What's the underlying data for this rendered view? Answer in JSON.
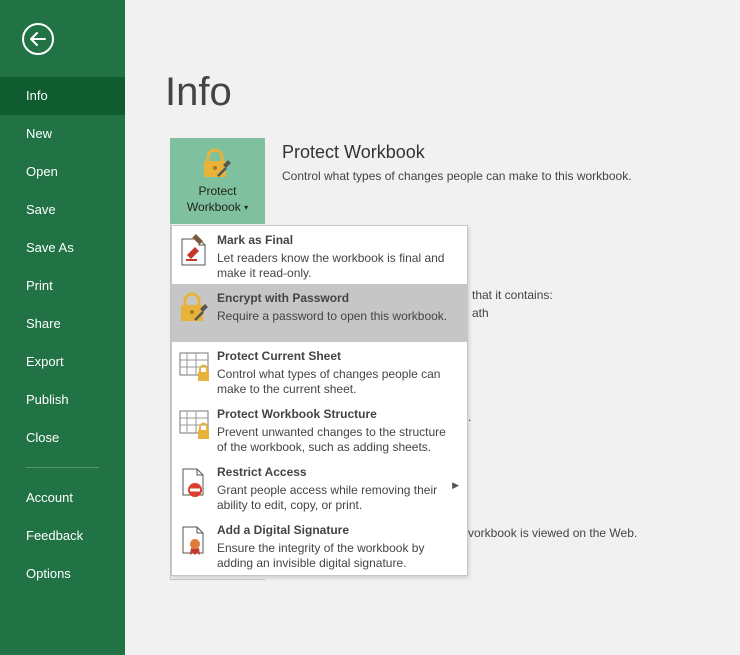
{
  "sidebar": {
    "items": [
      {
        "label": "Info",
        "active": true
      },
      {
        "label": "New"
      },
      {
        "label": "Open"
      },
      {
        "label": "Save"
      },
      {
        "label": "Save As"
      },
      {
        "label": "Print"
      },
      {
        "label": "Share"
      },
      {
        "label": "Export"
      },
      {
        "label": "Publish"
      },
      {
        "label": "Close"
      }
    ],
    "bottom_items": [
      {
        "label": "Account"
      },
      {
        "label": "Feedback"
      },
      {
        "label": "Options"
      }
    ]
  },
  "main": {
    "title": "Info",
    "protect": {
      "button_line1": "Protect",
      "button_line2": "Workbook",
      "heading": "Protect Workbook",
      "description": "Control what types of changes people can make to this workbook."
    },
    "background_fragments": {
      "contains": "that it contains:",
      "path": "ath",
      "dot": ".",
      "web": "vorkbook is viewed on the Web."
    }
  },
  "dropdown": {
    "items": [
      {
        "title": "Mark as Final",
        "description": "Let readers know the workbook is final and make it read-only.",
        "icon": "mark-final-icon"
      },
      {
        "title": "Encrypt with Password",
        "description": "Require a password to open this workbook.",
        "icon": "encrypt-lock-icon",
        "highlighted": true
      },
      {
        "title": "Protect Current Sheet",
        "description": "Control what types of changes people can make to the current sheet.",
        "icon": "protect-sheet-icon"
      },
      {
        "title": "Protect Workbook Structure",
        "description": "Prevent unwanted changes to the structure of the workbook, such as adding sheets.",
        "icon": "protect-structure-icon"
      },
      {
        "title": "Restrict Access",
        "description": "Grant people access while removing their ability to edit, copy, or print.",
        "icon": "restrict-access-icon",
        "has_submenu": true
      },
      {
        "title": "Add a Digital Signature",
        "description": "Ensure the integrity of the workbook by adding an invisible digital signature.",
        "icon": "digital-signature-icon"
      }
    ]
  },
  "colors": {
    "sidebar": "#217346",
    "sidebar_active": "#0e5c2f",
    "protect_button": "#7fc19e",
    "highlight": "#c6c6c6",
    "lock_gold": "#e8b33a"
  }
}
